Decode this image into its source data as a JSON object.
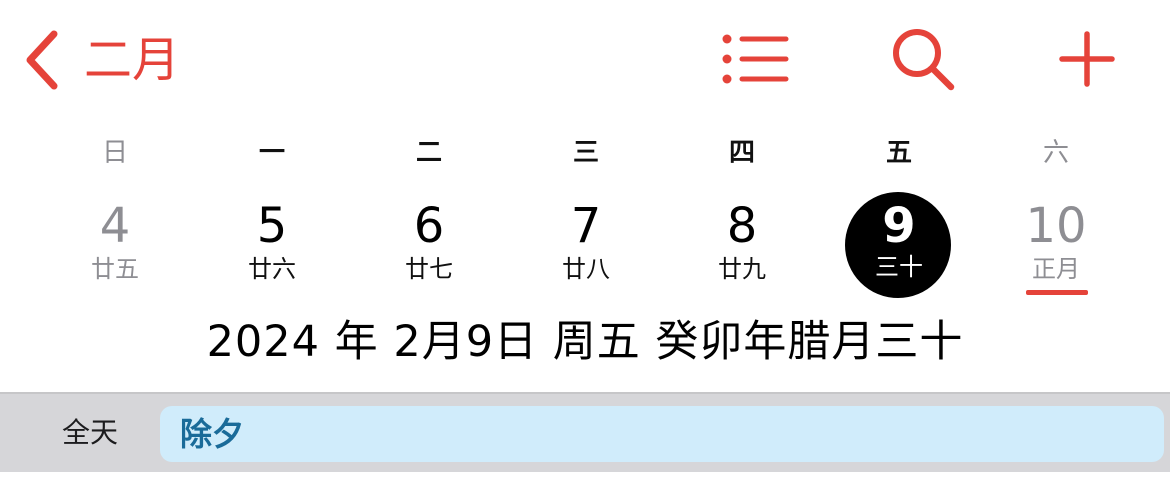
{
  "nav": {
    "back_label": "二月",
    "icons": {
      "back": "chevron-left-icon",
      "list": "list-icon",
      "search": "search-icon",
      "add": "plus-icon"
    }
  },
  "week": {
    "weekdays": [
      "日",
      "一",
      "二",
      "三",
      "四",
      "五",
      "六"
    ],
    "days": [
      {
        "num": "4",
        "lunar": "廿五"
      },
      {
        "num": "5",
        "lunar": "廿六"
      },
      {
        "num": "6",
        "lunar": "廿七"
      },
      {
        "num": "7",
        "lunar": "廿八"
      },
      {
        "num": "8",
        "lunar": "廿九"
      },
      {
        "num": "9",
        "lunar": "三十"
      },
      {
        "num": "10",
        "lunar": "正月"
      }
    ]
  },
  "selected_date": "2024 年 2月9日 周五   癸卯年腊月三十",
  "all_day": {
    "label": "全天",
    "event": "除夕"
  },
  "colors": {
    "accent": "#e5433a",
    "event_bg": "#d0ecfb",
    "event_text": "#1a6b99",
    "band_bg": "#d6d6d9"
  }
}
